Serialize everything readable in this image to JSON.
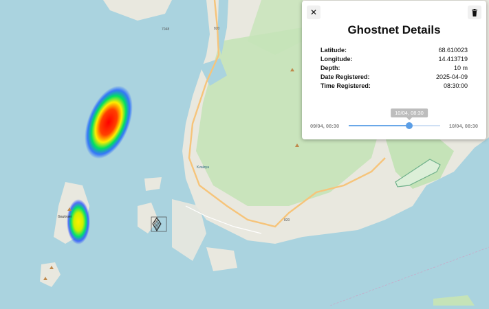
{
  "map": {
    "road_labels": [
      "820",
      "820",
      "7048",
      "820"
    ],
    "place_labels": [
      "Gaukvær",
      "Kvaløya"
    ]
  },
  "panel": {
    "title": "Ghostnet Details",
    "fields": [
      {
        "key": "Latitude:",
        "value": "68.610023"
      },
      {
        "key": "Longitude:",
        "value": "14.413719"
      },
      {
        "key": "Depth:",
        "value": "10 m"
      },
      {
        "key": "Date Registered:",
        "value": "2025-04-09"
      },
      {
        "key": "Time Registered:",
        "value": "08:30:00"
      }
    ],
    "slider": {
      "min_label": "09/04, 08:30",
      "max_label": "10/04, 08:30",
      "current_label": "10/04, 08:30",
      "value_fraction": 0.66
    }
  },
  "icons": {
    "close": "close-icon",
    "delete": "trash-icon"
  },
  "colors": {
    "slider_accent": "#5b9ee6",
    "water": "#aad3df",
    "land": "#e9e8df",
    "forest": "#c5e3b8"
  }
}
